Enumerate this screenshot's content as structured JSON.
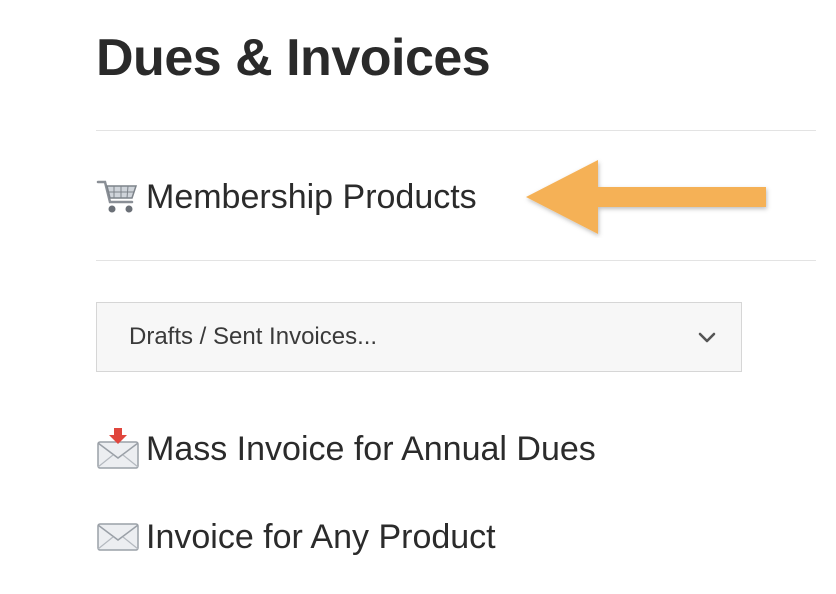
{
  "header": {
    "title": "Dues & Invoices"
  },
  "menu": {
    "membership_products": {
      "label": "Membership Products",
      "icon": "shopping-cart-icon"
    },
    "invoices_select": {
      "selected": "Drafts / Sent Invoices...",
      "icon": "chevron-down-icon"
    },
    "mass_invoice": {
      "label": "Mass Invoice for Annual Dues",
      "icon": "incoming-envelope-icon"
    },
    "invoice_any": {
      "label": "Invoice for Any Product",
      "icon": "envelope-icon"
    }
  },
  "annotation": {
    "arrow_color": "#f5b156"
  }
}
